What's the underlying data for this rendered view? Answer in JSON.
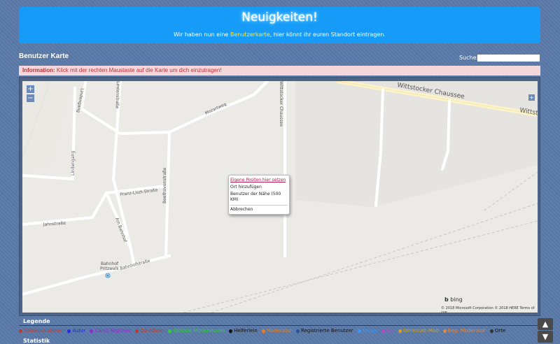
{
  "news": {
    "title": "Neuigkeiten!",
    "text_before": "Wir haben nun eine ",
    "text_highlight": "Benutzerkarte",
    "text_after": ", hier könnt ihr euren Standort eintragen."
  },
  "page": {
    "title": "Benutzer Karte"
  },
  "search": {
    "label": "Suche:",
    "value": "",
    "placeholder": ""
  },
  "info": {
    "label": "Information:",
    "text": " Klick mit der rechten Maustaste auf die Karte um dich einzutragen!"
  },
  "map": {
    "zoom_in": "+",
    "zoom_out": "−",
    "expand": "+",
    "labels": {
      "wittstocker": "Wittstocker Chaussee",
      "wittstocker2": "Wittsto",
      "wittstocker_v": "Wittstocker Chaussee",
      "lindenstr": "Lindenstraße",
      "lindengang": "Lindengang",
      "lindengang2": "Lindengang",
      "mozartweg": "Mozartweg",
      "liszt": "Franz-Liszt-Straße",
      "beethoven": "Beethovenstraße",
      "jahnstr": "Jahnstraße",
      "ambahnhof": "Am Bahnhof",
      "bahnhofstr": "Bahnhofstraße",
      "station1": "Bahnhof",
      "station2": "Pritzwalk"
    },
    "context_menu": {
      "own_position": "Eigene Positon hier setzen",
      "add_place": "Ort hinzufügen",
      "users_nearby_1": "Benutzer der Nähe (500",
      "users_nearby_2": "KM)",
      "cancel": "Abbrechen"
    },
    "bing": "bing",
    "copyright": "© 2018 Microsoft Corporation © 2018 HERE Terms of use"
  },
  "legend": {
    "title": "Legende",
    "items": [
      {
        "label": "Administratoren",
        "color": "#c0392b"
      },
      {
        "label": "Autor",
        "color": "#1e2fd8"
      },
      {
        "label": "CarcC-BigOnes",
        "color": "#8e2bd0"
      },
      {
        "label": "Co-Admin",
        "color": "#c0392b"
      },
      {
        "label": "Globale Moderatoren",
        "color": "#2ecc40"
      },
      {
        "label": "Helferlein",
        "color": "#111111"
      },
      {
        "label": "Moderator",
        "color": "#e67e22"
      },
      {
        "label": "Registrierte Benutzer",
        "color": "#2a4fa0"
      },
      {
        "label": "Tester",
        "color": "#3399ff"
      },
      {
        "label": "Vip",
        "color": "#c040d0"
      },
      {
        "label": "Werkstatt-Mod",
        "color": "#d4a017"
      },
      {
        "label": "Beg. Moderator",
        "color": "#e8843a"
      },
      {
        "label": "Orte",
        "color": "#333333"
      }
    ]
  },
  "stats": {
    "title": "Statistik"
  },
  "scroll": {
    "up": "▲",
    "down": "▼"
  }
}
